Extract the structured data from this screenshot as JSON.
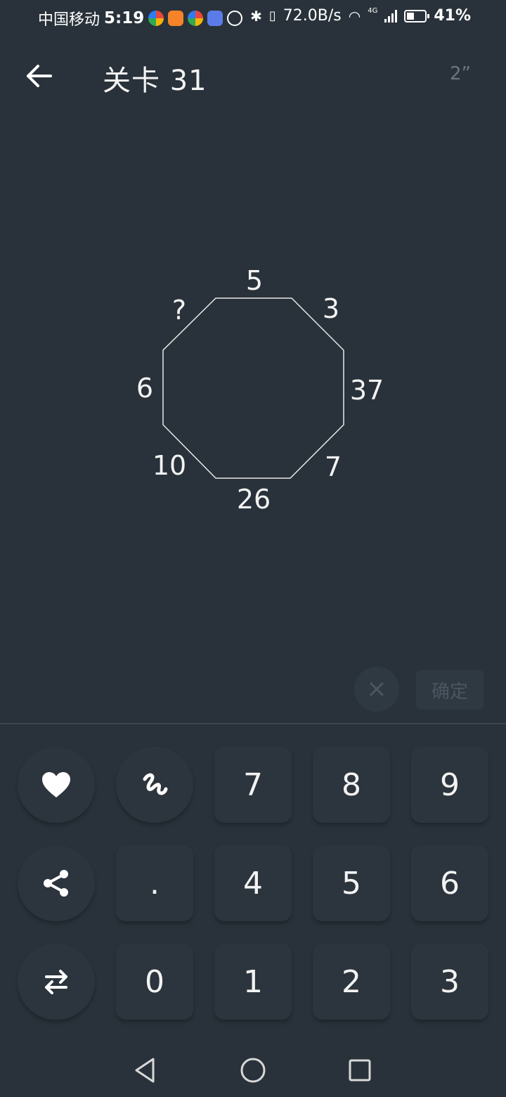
{
  "status_bar": {
    "carrier": "中国移动",
    "time": "5:19",
    "network_speed": "72.0B/s",
    "network_type": "4G",
    "battery": "41%"
  },
  "header": {
    "title": "关卡 31",
    "timer": "2”"
  },
  "puzzle": {
    "labels": {
      "top": "5",
      "top_right": "3",
      "right": "37",
      "bottom_right": "7",
      "bottom": "26",
      "bottom_left": "10",
      "left": "6",
      "top_left": "?"
    }
  },
  "answer_bar": {
    "clear_icon": "close-icon",
    "confirm_label": "确定"
  },
  "keypad": {
    "heart_icon": "heart-icon",
    "hint_icon": "squiggle-icon",
    "share_icon": "share-icon",
    "swap_icon": "swap-arrows-icon",
    "keys": {
      "k7": "7",
      "k8": "8",
      "k9": "9",
      "kdot": ".",
      "k4": "4",
      "k5": "5",
      "k6": "6",
      "k0": "0",
      "k1": "1",
      "k2": "2",
      "k3": "3"
    }
  },
  "nav": {
    "back_icon": "triangle-back-icon",
    "home_icon": "circle-home-icon",
    "recent_icon": "square-recent-icon"
  },
  "colors": {
    "background": "#29323a",
    "key": "#2c353d",
    "muted": "#4b5660"
  }
}
